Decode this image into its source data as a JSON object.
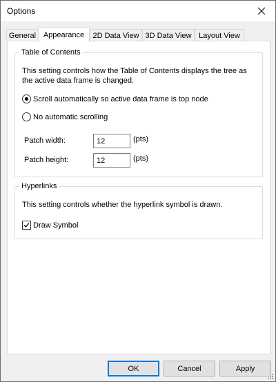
{
  "window": {
    "title": "Options"
  },
  "tabs": [
    {
      "label": "General"
    },
    {
      "label": "Appearance"
    },
    {
      "label": "2D Data View"
    },
    {
      "label": "3D Data View"
    },
    {
      "label": "Layout View"
    }
  ],
  "toc": {
    "legend": "Table of Contents",
    "description": "This setting controls how the Table of Contents displays the tree as the active data frame is changed.",
    "radio_scroll_label": "Scroll automatically so active data frame is top node",
    "radio_scroll_checked": true,
    "radio_none_label": "No automatic scrolling",
    "patch_width_label": "Patch width:",
    "patch_width_value": "12",
    "patch_width_unit": "(pts)",
    "patch_height_label": "Patch height:",
    "patch_height_value": "12",
    "patch_height_unit": "(pts)"
  },
  "hyperlinks": {
    "legend": "Hyperlinks",
    "description": "This setting controls whether the hyperlink symbol is drawn.",
    "draw_symbol_label": "Draw Symbol",
    "draw_symbol_checked": true
  },
  "buttons": {
    "ok": "OK",
    "cancel": "Cancel",
    "apply": "Apply"
  },
  "icons": [
    "close-icon",
    "checkmark-icon",
    "size-grip-icon"
  ],
  "colors": {
    "default_button_border": "#0078d7"
  }
}
